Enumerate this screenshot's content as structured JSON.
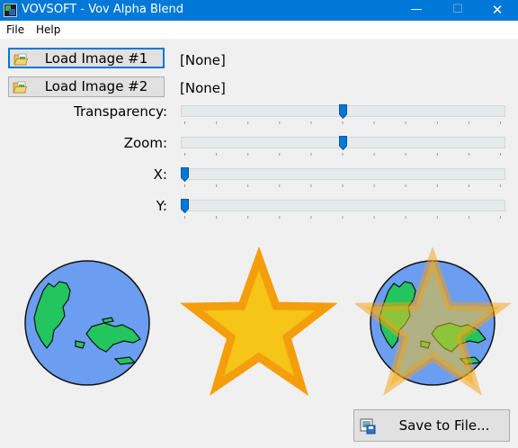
{
  "window": {
    "title": "VOVSOFT - Vov Alpha Blend",
    "minimize_glyph": "—",
    "maximize_glyph": "☐",
    "close_glyph": "✕"
  },
  "menu": {
    "file": "File",
    "help": "Help"
  },
  "images": [
    {
      "button_label": "Load Image #1",
      "file": "[None]",
      "icon": "folder-open-icon"
    },
    {
      "button_label": "Load Image #2",
      "file": "[None]",
      "icon": "folder-open-icon"
    }
  ],
  "sliders": [
    {
      "label": "Transparency:",
      "value_fraction": 0.5
    },
    {
      "label": "Zoom:",
      "value_fraction": 0.5
    },
    {
      "label": "X:",
      "value_fraction": 0.0
    },
    {
      "label": "Y:",
      "value_fraction": 0.0
    }
  ],
  "slider_tick_count": 11,
  "save": {
    "label": "Save to File...",
    "icon": "save-image-icon"
  },
  "colors": {
    "titlebar": "#0078d7",
    "slider_thumb": "#0078d7",
    "globe_ocean": "#6b9ef0",
    "globe_land": "#22c55e",
    "star_fill": "#f5c518",
    "star_stroke": "#f59e0b"
  }
}
